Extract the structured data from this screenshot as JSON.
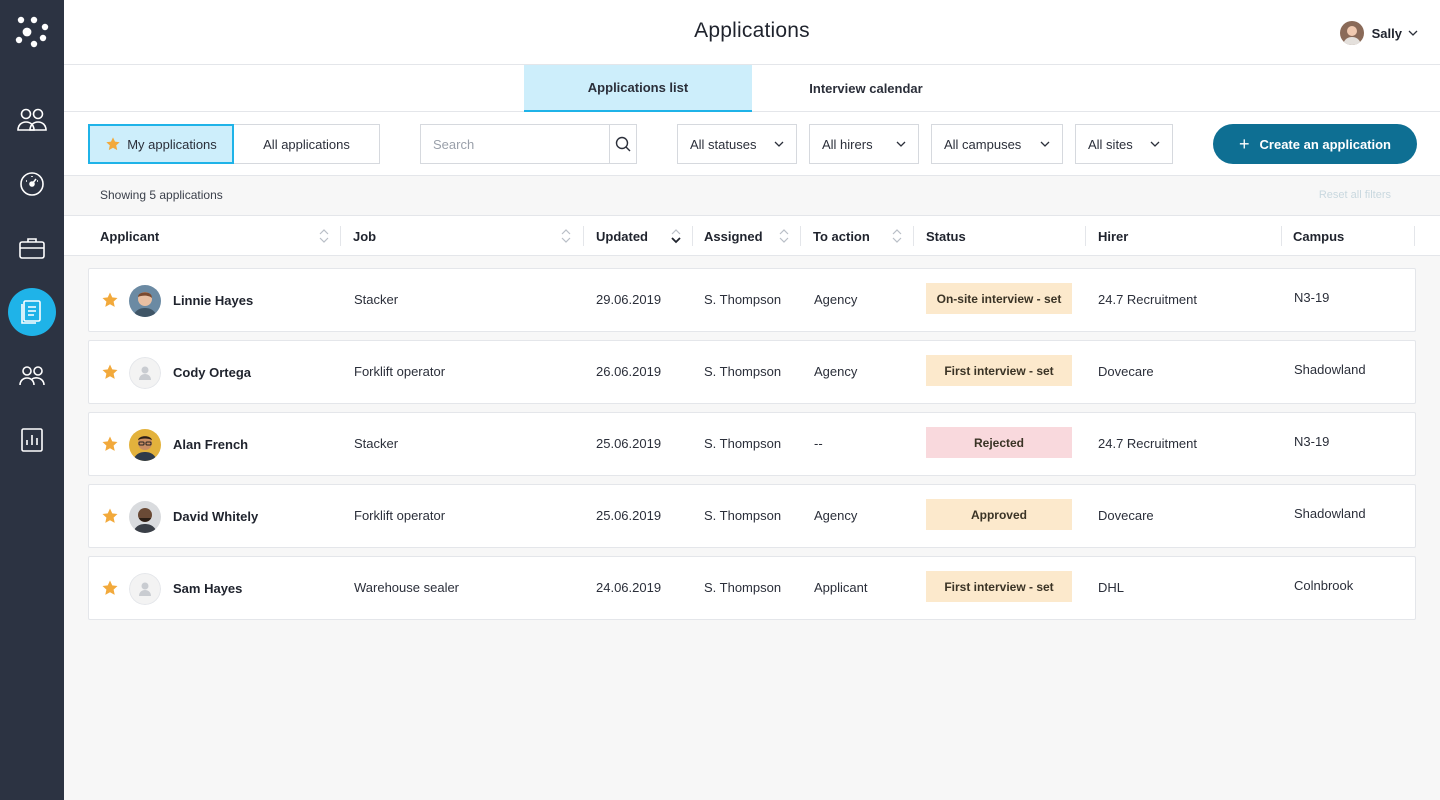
{
  "header": {
    "title": "Applications",
    "user_name": "Sally"
  },
  "tabs": [
    {
      "label": "Applications list",
      "active": true
    },
    {
      "label": "Interview calendar",
      "active": false
    }
  ],
  "toolbar": {
    "my_applications": "My applications",
    "all_applications": "All applications",
    "search_placeholder": "Search",
    "filters": {
      "statuses": "All statuses",
      "hirers": "All hirers",
      "campuses": "All campuses",
      "sites": "All sites"
    },
    "create_label": "Create an application"
  },
  "info": {
    "showing": "Showing 5 applications",
    "reset": "Reset all filters"
  },
  "table": {
    "columns": [
      "Applicant",
      "Job",
      "Updated",
      "Assigned",
      "To action",
      "Status",
      "Hirer",
      "Campus"
    ],
    "rows": [
      {
        "name": "Linnie Hayes",
        "job": "Stacker",
        "updated": "29.06.2019",
        "assigned": "S. Thompson",
        "action": "Agency",
        "status": "On-site interview - set",
        "hirer": "24.7 Recruitment",
        "campus": "N3-19"
      },
      {
        "name": "Cody Ortega",
        "job": "Forklift operator",
        "updated": "26.06.2019",
        "assigned": "S. Thompson",
        "action": "Agency",
        "status": "First interview - set",
        "hirer": "Dovecare",
        "campus": "Shadowland"
      },
      {
        "name": "Alan French",
        "job": "Stacker",
        "updated": "25.06.2019",
        "assigned": "S. Thompson",
        "action": "--",
        "status": "Rejected",
        "hirer": "24.7 Recruitment",
        "campus": "N3-19"
      },
      {
        "name": "David Whitely",
        "job": "Forklift operator",
        "updated": "25.06.2019",
        "assigned": "S. Thompson",
        "action": "Agency",
        "status": "Approved",
        "hirer": "Dovecare",
        "campus": "Shadowland"
      },
      {
        "name": "Sam Hayes",
        "job": "Warehouse sealer",
        "updated": "24.06.2019",
        "assigned": "S. Thompson",
        "action": "Applicant",
        "status": "First interview - set",
        "hirer": "DHL",
        "campus": "Colnbrook"
      }
    ]
  },
  "colors": {
    "sidebar": "#2c3342",
    "accent": "#1fb3e8",
    "primary_button": "#0e6f93",
    "star": "#f2a93b",
    "status_warm": "#fce9cc",
    "status_rejected": "#f9d9dd"
  },
  "icons": {
    "sidebar": [
      "people-icon",
      "dashboard-icon",
      "briefcase-icon",
      "documents-icon",
      "team-icon",
      "chart-icon"
    ]
  }
}
